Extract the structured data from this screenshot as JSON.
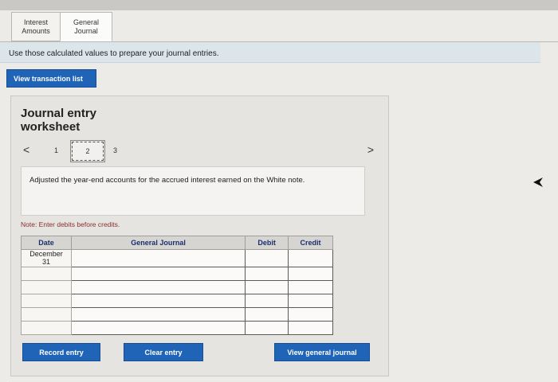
{
  "tabs": [
    {
      "label_line1": "Interest",
      "label_line2": "Amounts"
    },
    {
      "label_line1": "General",
      "label_line2": "Journal"
    }
  ],
  "instruction": "Use those calculated values to prepare your journal entries.",
  "view_transaction_list": "View transaction list",
  "worksheet": {
    "title_line1": "Journal entry",
    "title_line2": "worksheet",
    "pager": {
      "prev": "<",
      "next": ">",
      "pages": [
        "1",
        "2",
        "3"
      ]
    },
    "description": "Adjusted the year-end accounts for the accrued interest earned on the White note.",
    "note": "Note: Enter debits before credits.",
    "table": {
      "headers": {
        "date": "Date",
        "account": "General Journal",
        "debit": "Debit",
        "credit": "Credit"
      },
      "first_date_line1": "December",
      "first_date_line2": "31"
    },
    "buttons": {
      "record": "Record entry",
      "clear": "Clear entry",
      "view_general_journal": "View general journal"
    }
  },
  "colors": {
    "button_blue": "#1f64b7",
    "instruction_bg": "#dbe5ea",
    "note_red": "#8b2f2f"
  }
}
